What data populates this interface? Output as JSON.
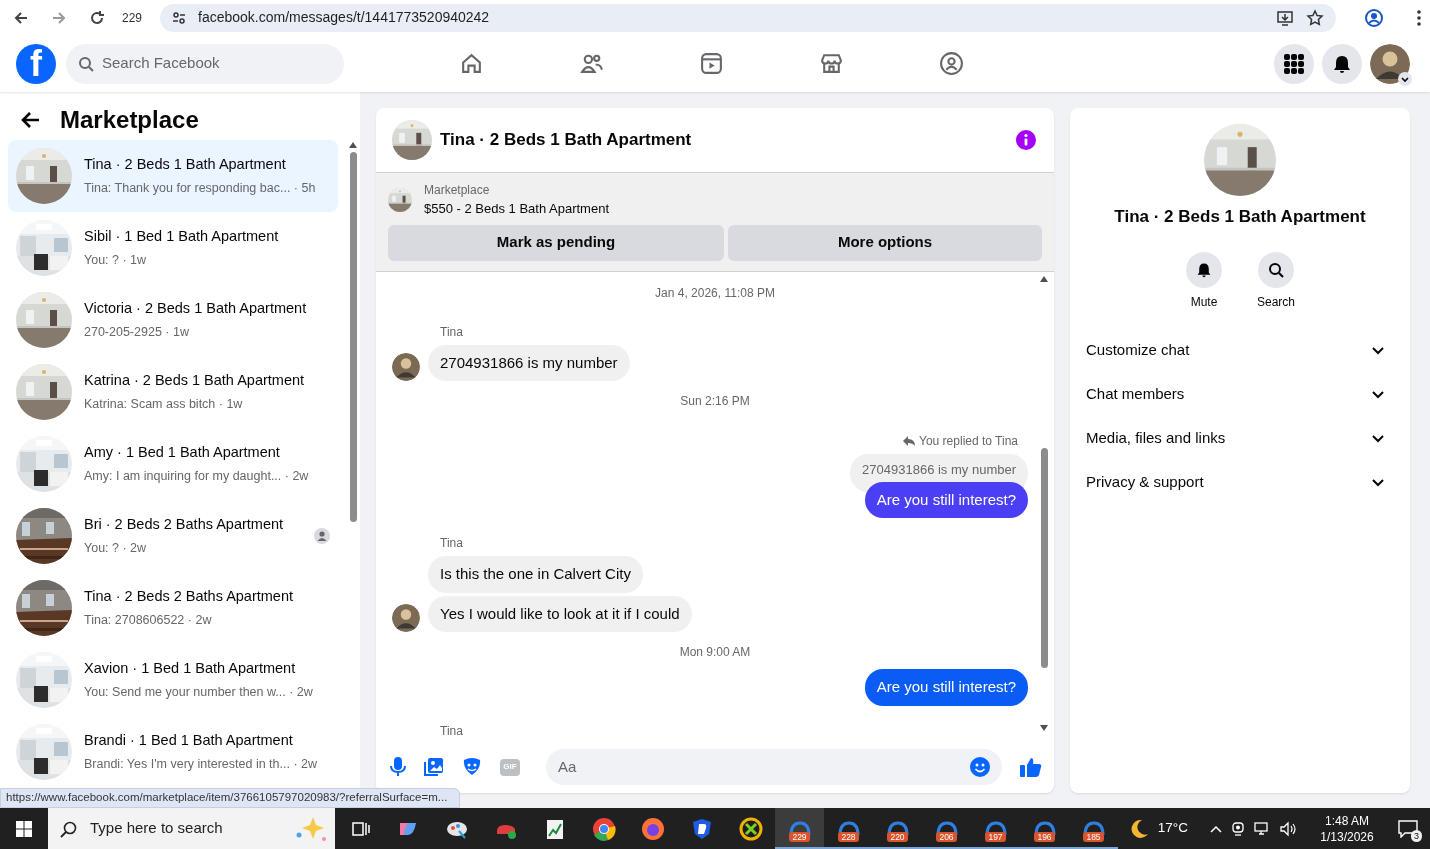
{
  "browser": {
    "tab_count": "229",
    "url": "facebook.com/messages/t/1441773520940242"
  },
  "header": {
    "logo": "f",
    "search_placeholder": "Search Facebook"
  },
  "sidebar": {
    "title": "Marketplace",
    "conversations": [
      {
        "title": "Tina · 2 Beds 1 Bath Apartment",
        "preview": "Tina: Thank you for responding bac... · 5h",
        "selected": true,
        "seen": false
      },
      {
        "title": "Sibil · 1 Bed 1 Bath Apartment",
        "preview": "You: ? · 1w",
        "selected": false,
        "seen": false
      },
      {
        "title": "Victoria · 2 Beds 1 Bath Apartment",
        "preview": "270-205-2925 · 1w",
        "selected": false,
        "seen": false
      },
      {
        "title": "Katrina · 2 Beds 1 Bath Apartment",
        "preview": "Katrina: Scam ass bitch · 1w",
        "selected": false,
        "seen": false
      },
      {
        "title": "Amy · 1 Bed 1 Bath Apartment",
        "preview": "Amy: I am inquiring for my daught... · 2w",
        "selected": false,
        "seen": false
      },
      {
        "title": "Bri · 2 Beds 2 Baths Apartment",
        "preview": "You: ? · 2w",
        "selected": false,
        "seen": true
      },
      {
        "title": "Tina · 2 Beds 2 Baths Apartment",
        "preview": "Tina: 2708606522 · 2w",
        "selected": false,
        "seen": false
      },
      {
        "title": "Xavion · 1 Bed 1 Bath Apartment",
        "preview": "You: Send me your number then w... · 2w",
        "selected": false,
        "seen": false
      },
      {
        "title": "Brandi · 1 Bed 1 Bath Apartment",
        "preview": "Brandi: Yes I'm very interested in th... · 2w",
        "selected": false,
        "seen": false
      }
    ]
  },
  "chat": {
    "title": "Tina · 2 Beds 1 Bath Apartment",
    "listing": {
      "label": "Marketplace",
      "title": "$550 - 2 Beds 1 Bath Apartment"
    },
    "actions": [
      "Mark as pending",
      "More options"
    ],
    "messages": [
      {
        "kind": "timestamp",
        "text": "Jan 4, 2026, 11:08 PM"
      },
      {
        "kind": "sender",
        "text": "Tina"
      },
      {
        "kind": "incoming",
        "text": "2704931866 is my number",
        "avatar": true
      },
      {
        "kind": "timestamp",
        "text": "Sun 2:16 PM"
      },
      {
        "kind": "reply",
        "label": "You replied to Tina",
        "quote": "2704931866 is my number"
      },
      {
        "kind": "outgoing",
        "text": "Are you still interest?",
        "color": "#4a3ff5"
      },
      {
        "kind": "sender",
        "text": "Tina"
      },
      {
        "kind": "incoming",
        "text": "Is this the one in Calvert City",
        "avatar": false
      },
      {
        "kind": "incoming",
        "text": "Yes I would like to look at it if I could",
        "avatar": true
      },
      {
        "kind": "timestamp",
        "text": "Mon 9:00 AM"
      },
      {
        "kind": "outgoing",
        "text": "Are you still interest?",
        "color": "#0a5cf5"
      },
      {
        "kind": "sender",
        "text": "Tina"
      }
    ],
    "composer": {
      "gif": "GIF",
      "placeholder": "Aa"
    }
  },
  "details": {
    "title": "Tina · 2 Beds 1 Bath Apartment",
    "actions": [
      "Mute",
      "Search"
    ],
    "sections": [
      "Customize chat",
      "Chat members",
      "Media, files and links",
      "Privacy & support"
    ]
  },
  "status_url": "https://www.facebook.com/marketplace/item/3766105797020983/?referralSurface=m...",
  "taskbar": {
    "search_placeholder": "Type here to search",
    "window_badges": [
      "229",
      "228",
      "220",
      "206",
      "197",
      "196",
      "185"
    ],
    "temperature": "17°C",
    "time": "1:48 AM",
    "date": "1/13/2026",
    "notifications": "3"
  }
}
